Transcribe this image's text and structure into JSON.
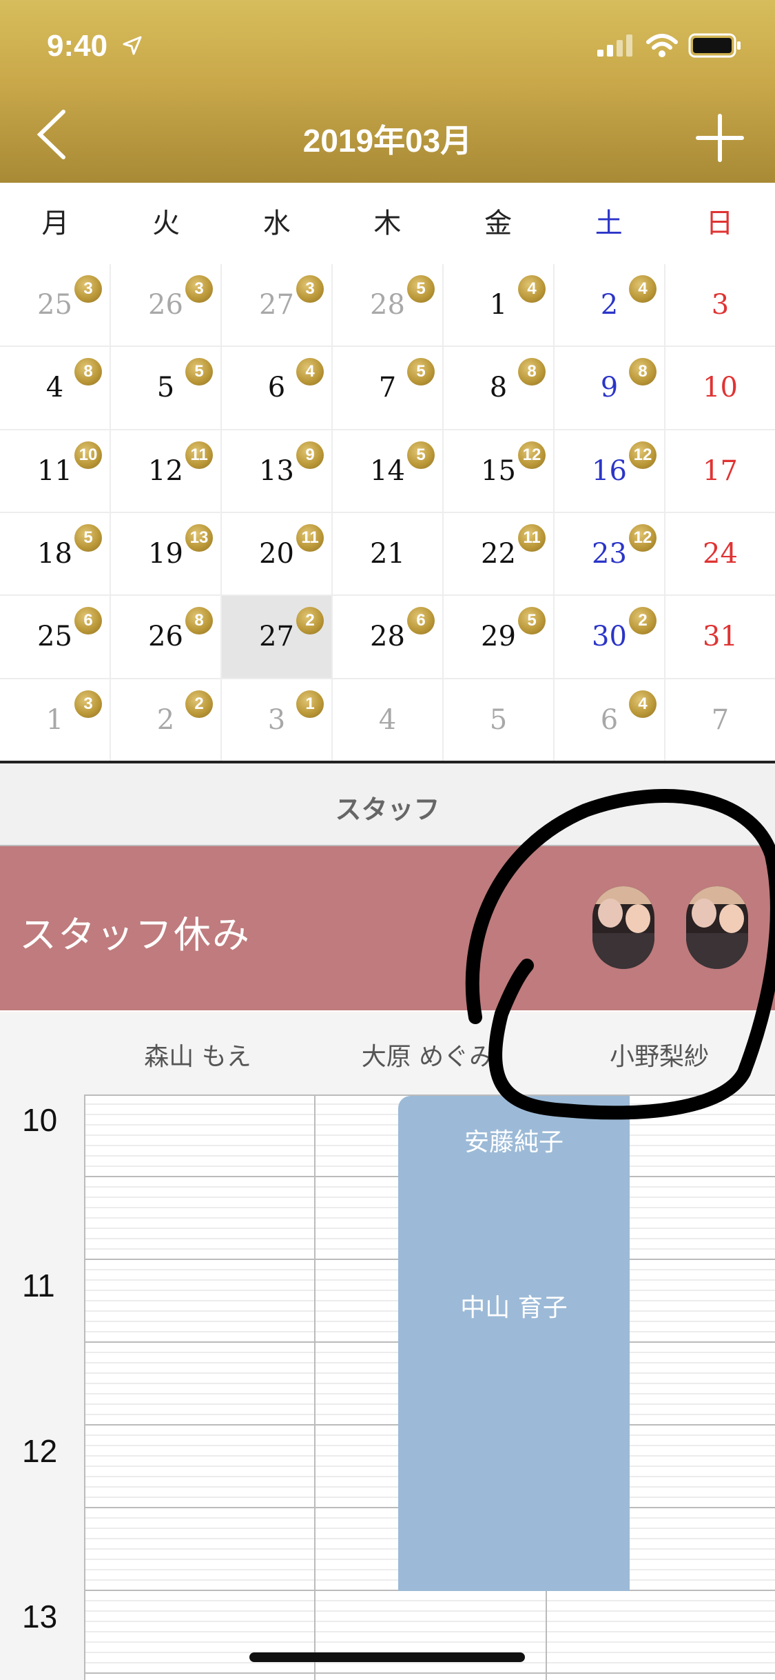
{
  "status_bar": {
    "time": "9:40"
  },
  "header": {
    "title": "2019年03月",
    "colors": {
      "gold": "#c9a84a"
    }
  },
  "weekdays": [
    "月",
    "火",
    "水",
    "木",
    "金",
    "土",
    "日"
  ],
  "calendar": {
    "weeks": [
      [
        {
          "day": "25",
          "badge": "3",
          "other": true
        },
        {
          "day": "26",
          "badge": "3",
          "other": true
        },
        {
          "day": "27",
          "badge": "3",
          "other": true
        },
        {
          "day": "28",
          "badge": "5",
          "other": true
        },
        {
          "day": "1",
          "badge": "4"
        },
        {
          "day": "2",
          "badge": "4"
        },
        {
          "day": "3",
          "badge": ""
        }
      ],
      [
        {
          "day": "4",
          "badge": "8"
        },
        {
          "day": "5",
          "badge": "5"
        },
        {
          "day": "6",
          "badge": "4"
        },
        {
          "day": "7",
          "badge": "5"
        },
        {
          "day": "8",
          "badge": "8"
        },
        {
          "day": "9",
          "badge": "8"
        },
        {
          "day": "10",
          "badge": ""
        }
      ],
      [
        {
          "day": "11",
          "badge": "10"
        },
        {
          "day": "12",
          "badge": "11"
        },
        {
          "day": "13",
          "badge": "9"
        },
        {
          "day": "14",
          "badge": "5"
        },
        {
          "day": "15",
          "badge": "12"
        },
        {
          "day": "16",
          "badge": "12"
        },
        {
          "day": "17",
          "badge": ""
        }
      ],
      [
        {
          "day": "18",
          "badge": "5"
        },
        {
          "day": "19",
          "badge": "13"
        },
        {
          "day": "20",
          "badge": "11"
        },
        {
          "day": "21",
          "badge": ""
        },
        {
          "day": "22",
          "badge": "11"
        },
        {
          "day": "23",
          "badge": "12"
        },
        {
          "day": "24",
          "badge": ""
        }
      ],
      [
        {
          "day": "25",
          "badge": "6"
        },
        {
          "day": "26",
          "badge": "8"
        },
        {
          "day": "27",
          "badge": "2",
          "selected": true
        },
        {
          "day": "28",
          "badge": "6"
        },
        {
          "day": "29",
          "badge": "5"
        },
        {
          "day": "30",
          "badge": "2"
        },
        {
          "day": "31",
          "badge": ""
        }
      ],
      [
        {
          "day": "1",
          "badge": "3",
          "other": true
        },
        {
          "day": "2",
          "badge": "2",
          "other": true
        },
        {
          "day": "3",
          "badge": "1",
          "other": true
        },
        {
          "day": "4",
          "badge": "",
          "other": true
        },
        {
          "day": "5",
          "badge": "",
          "other": true
        },
        {
          "day": "6",
          "badge": "4",
          "other": true
        },
        {
          "day": "7",
          "badge": "",
          "other": true
        }
      ]
    ]
  },
  "staff_section": {
    "header": "スタッフ",
    "off_label": "スタッフ休み"
  },
  "staff_names": [
    "森山 もえ",
    "大原 めぐみ",
    "小野梨紗"
  ],
  "hours": [
    "10",
    "11",
    "12",
    "13"
  ],
  "appointments": [
    "安藤純子",
    "中山 育子"
  ]
}
